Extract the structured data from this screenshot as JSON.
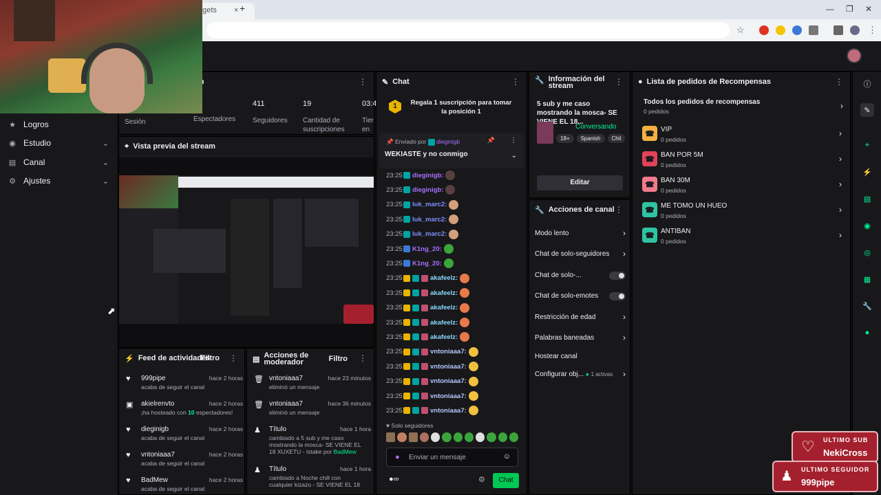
{
  "browser": {
    "tab_partial": "dgets",
    "tab_close": "×",
    "tab_new": "+"
  },
  "nav": {
    "items": [
      {
        "label": "Logros",
        "icon": "trophy-icon"
      },
      {
        "label": "Estudio",
        "icon": "studio-icon"
      },
      {
        "label": "Canal",
        "icon": "channel-icon"
      },
      {
        "label": "Ajustes",
        "icon": "gear-icon"
      }
    ]
  },
  "session": {
    "title_partial": "ón",
    "session_label": "Sesión",
    "viewers_label": "Espectadores",
    "followers_value": "411",
    "followers_label": "Seguidores",
    "subs_value": "19",
    "subs_label": "Cantidad de suscripciones",
    "time_partial": "03:4",
    "time_label_partial": "Tier en v"
  },
  "preview": {
    "title": "Vista previa del stream"
  },
  "feed": {
    "title": "Feed de actividades",
    "filter": "Filtro",
    "rows": [
      {
        "name": "999pipe",
        "time": "hace 2 horas",
        "desc": "acaba de seguir el canal"
      },
      {
        "name": "akielrenvto",
        "time": "hace 2 horas",
        "desc_pre": "¡ha hosteado con ",
        "desc_num": "10",
        "desc_post": " espectadores!"
      },
      {
        "name": "dieginigb",
        "time": "hace 2 horas",
        "desc": "acaba de seguir el canal"
      },
      {
        "name": "vntoniaaa7",
        "time": "hace 2 horas",
        "desc": "acaba de seguir el canal"
      },
      {
        "name": "BadMew",
        "time": "hace 2 horas",
        "desc": "acaba de seguir el canal"
      }
    ]
  },
  "mod": {
    "title": "Acciones de moderador",
    "filter": "Filtro",
    "rows": [
      {
        "name": "vntoniaaa7",
        "time": "hace 23 minutos",
        "desc": "eliminó un mensaje"
      },
      {
        "name": "vntoniaaa7",
        "time": "hace 36 minutos",
        "desc": "eliminó un mensaje"
      },
      {
        "name": "Título",
        "time": "hace 1 hora",
        "desc": "cambiado a 5 sub y me caso mostrando la mosca- SE VIENE EL 18 XUXETU - Istake",
        "by": "por",
        "who": "BadMew"
      },
      {
        "name": "Título",
        "time": "hace 1 hora",
        "desc": "cambiado a Noche chill con cualquier kizazo - SE VIENE EL 18"
      }
    ]
  },
  "chat": {
    "title": "Chat",
    "gift_count": "1",
    "gift_text": "Regala 1 suscripción para tomar la posición 1",
    "pinned_by": "Enviado por",
    "pinned_user": "dieginigb",
    "pinned_msg": "WEKIASTE y no conmigo",
    "lines": [
      {
        "time": "23:25",
        "user": "dieginigb:",
        "color": "#a970ff"
      },
      {
        "time": "23:25",
        "user": "dieginigb:",
        "color": "#a970ff"
      },
      {
        "time": "23:25",
        "user": "luk_marc2:",
        "color": "#7b90ff"
      },
      {
        "time": "23:25",
        "user": "luk_marc2:",
        "color": "#7b90ff"
      },
      {
        "time": "23:25",
        "user": "luk_marc2:",
        "color": "#7b90ff"
      },
      {
        "time": "23:25",
        "user": "K1ng_20:",
        "color": "#a970ff"
      },
      {
        "time": "23:25",
        "user": "K1ng_20:",
        "color": "#a970ff"
      },
      {
        "time": "23:25",
        "user": "akafeelz:",
        "color": "#8ad9ff"
      },
      {
        "time": "23:25",
        "user": "akafeelz:",
        "color": "#8ad9ff"
      },
      {
        "time": "23:25",
        "user": "akafeelz:",
        "color": "#8ad9ff"
      },
      {
        "time": "23:25",
        "user": "akafeelz:",
        "color": "#8ad9ff"
      },
      {
        "time": "23:25",
        "user": "akafeelz:",
        "color": "#8ad9ff"
      },
      {
        "time": "23:25",
        "user": "vntoniaaa7:",
        "color": "#b5c8ff"
      },
      {
        "time": "23:25",
        "user": "vntoniaaa7:",
        "color": "#b5c8ff"
      },
      {
        "time": "23:25",
        "user": "vntoniaaa7:",
        "color": "#b5c8ff"
      },
      {
        "time": "23:25",
        "user": "vntoniaaa7:",
        "color": "#b5c8ff"
      },
      {
        "time": "23:25",
        "user": "vntoniaaa7:",
        "color": "#b5c8ff"
      }
    ],
    "followers_only": "Solo seguidores",
    "placeholder": "Enviar un mensaje",
    "send": "Chat"
  },
  "info": {
    "title": "Información del stream",
    "stream_title": "5 sub y me caso mostrando la mosca- SE VIENE EL 18...",
    "category": "Conversando",
    "tags": [
      "18+",
      "Spanish",
      "Chil"
    ],
    "edit": "Editar"
  },
  "channel_actions": {
    "title": "Acciones de canal",
    "items": [
      {
        "label": "Modo lento",
        "kind": "chev"
      },
      {
        "label": "Chat de solo-seguidores",
        "kind": "chev"
      },
      {
        "label": "Chat de solo-...",
        "kind": "toggle"
      },
      {
        "label": "Chat de solo-emotes",
        "kind": "toggle"
      },
      {
        "label": "Restricción de edad",
        "kind": "chev"
      },
      {
        "label": "Palabras baneadas",
        "kind": "chev"
      },
      {
        "label": "Hostear canal",
        "kind": "none"
      },
      {
        "label": "Configurar obj...",
        "kind": "chev",
        "extra": "1 activas"
      }
    ]
  },
  "rewards": {
    "title": "Lista de pedidos de Recompensas",
    "all_label": "Todos los pedidos de recompensas",
    "all_count": "0 pedidos",
    "items": [
      {
        "name": "VIP",
        "count": "0 pedidos",
        "color": "#f5b041"
      },
      {
        "name": "BAN POR 5M",
        "count": "0 pedidos",
        "color": "#e0435a"
      },
      {
        "name": "BAN 30M",
        "count": "0 pedidos",
        "color": "#f07b8c"
      },
      {
        "name": "ME TOMO UN HUEO",
        "count": "0 pedidos",
        "color": "#2ec4a3"
      },
      {
        "name": "ANTIBAN",
        "count": "0 pedidos",
        "color": "#2ec4a3"
      }
    ]
  },
  "overlay": {
    "sub_label": "ULTIMO SUB",
    "sub_name": "NekiCross",
    "follow_label": "ULTIMO SEGUIDOR",
    "follow_name": "999pipe"
  }
}
